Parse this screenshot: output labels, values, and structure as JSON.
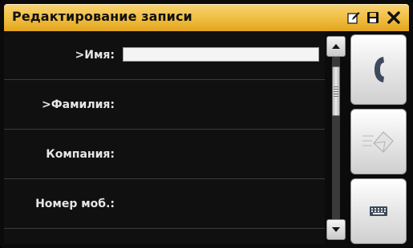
{
  "window": {
    "title": "Редактирование записи"
  },
  "titlebar_icons": [
    "edit-icon",
    "save-icon",
    "close-icon"
  ],
  "form": {
    "fields": [
      {
        "label": ">Имя:",
        "value": ""
      },
      {
        "label": ">Фамилия:"
      },
      {
        "label": "Компания:"
      },
      {
        "label": "Номер моб.:"
      }
    ]
  },
  "side_buttons": [
    "phone-call-icon",
    "send-message-icon",
    "keyboard-icon"
  ],
  "colors": {
    "titlebar": "#f0bd3f",
    "background": "#101010",
    "text": "#e6e6e6"
  }
}
